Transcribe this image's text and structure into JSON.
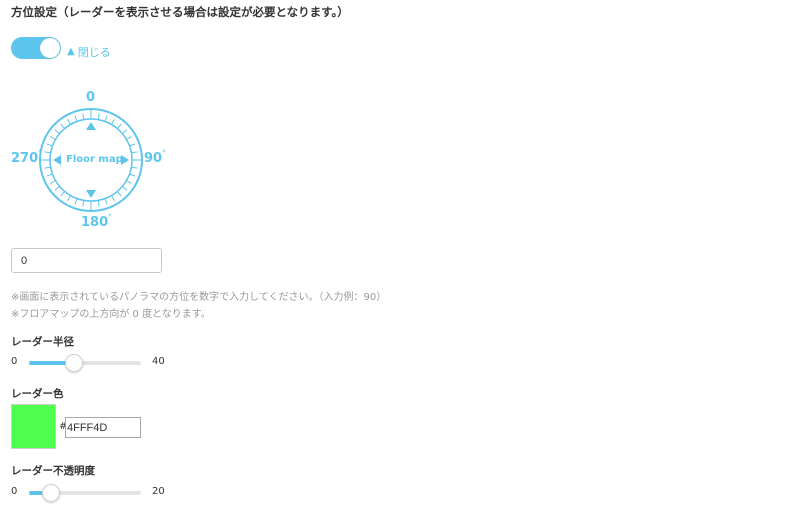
{
  "section": {
    "title": "方位設定（レーダーを表示させる場合は設定が必要となります。）"
  },
  "toggle": {
    "state": "on",
    "close_label": "閉じる",
    "close_icon": "triangle-up-icon"
  },
  "compass": {
    "north": "0",
    "east": "90",
    "south": "180",
    "west": "270",
    "degree_symbol": "°",
    "center_label": "Floor map",
    "color": "#5bc5ec"
  },
  "direction_input": {
    "value": "0"
  },
  "notes": {
    "line1": "※画面に表示されているパノラマの方位を数字で入力してください。（入力例：90）",
    "line2": "※フロアマップの上方向が 0 度となります。"
  },
  "radar_radius": {
    "label": "レーダー半径",
    "min": "0",
    "max": "40",
    "value_fraction": 0.4
  },
  "radar_color": {
    "label": "レーダー色",
    "hash": "#",
    "hex_value": "4FFF4D",
    "swatch_color": "#4fff4d"
  },
  "radar_opacity": {
    "label": "レーダー不透明度",
    "min": "0",
    "max": "20",
    "value_fraction": 0.2
  },
  "colors": {
    "accent": "#5bc5ec"
  }
}
